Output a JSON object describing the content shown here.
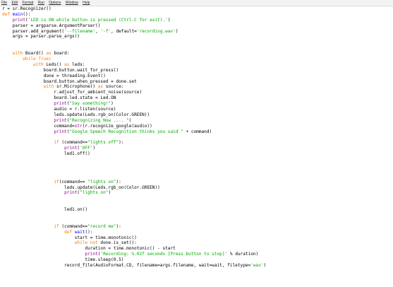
{
  "menu": [
    "File",
    "Edit",
    "Format",
    "Run",
    "Options",
    "Window",
    "Help"
  ],
  "colors": {
    "keyword": "#ff7700",
    "builtin": "#900090",
    "string": "#00aa00",
    "definition": "#0000ff",
    "default": "#000000",
    "background": "#ffffff"
  },
  "code_lines": [
    [
      [
        "",
        "r = sr.Recognizer()"
      ]
    ],
    [
      [
        "kw",
        "def "
      ],
      [
        "df",
        "main"
      ],
      [
        "",
        "():"
      ]
    ],
    [
      [
        "",
        "    "
      ],
      [
        "bi",
        "print"
      ],
      [
        "",
        "("
      ],
      [
        "str",
        "'LED is ON while button is pressed (Ctrl-C for exit).'"
      ],
      [
        "",
        ")"
      ]
    ],
    [
      [
        "",
        "    parser = argparse.ArgumentParser()"
      ]
    ],
    [
      [
        "",
        "    parser.add_argument("
      ],
      [
        "str",
        "'--filename'"
      ],
      [
        "",
        ", "
      ],
      [
        "str",
        "'-f'"
      ],
      [
        "",
        ", default="
      ],
      [
        "str",
        "'recording.wav'"
      ],
      [
        "",
        ")"
      ]
    ],
    [
      [
        "",
        "    args = parser.parse_args()"
      ]
    ],
    [
      [
        "",
        ""
      ]
    ],
    [
      [
        "",
        ""
      ]
    ],
    [
      [
        "",
        "    "
      ],
      [
        "kw",
        "with "
      ],
      [
        "",
        "Board() "
      ],
      [
        "kw",
        "as "
      ],
      [
        "",
        "board:"
      ]
    ],
    [
      [
        "",
        "        "
      ],
      [
        "kw",
        "while True"
      ],
      [
        "",
        ":"
      ]
    ],
    [
      [
        "",
        "            "
      ],
      [
        "kw",
        "with "
      ],
      [
        "",
        "Leds() "
      ],
      [
        "kw",
        "as "
      ],
      [
        "",
        "leds:"
      ]
    ],
    [
      [
        "",
        "                board.button.wait_for_press()"
      ]
    ],
    [
      [
        "",
        "                done = threading.Event()"
      ]
    ],
    [
      [
        "",
        "                board.button.when_pressed = done.set"
      ]
    ],
    [
      [
        "",
        "                "
      ],
      [
        "kw",
        "with "
      ],
      [
        "",
        "sr.Microphone() "
      ],
      [
        "kw",
        "as "
      ],
      [
        "",
        "source:"
      ]
    ],
    [
      [
        "",
        "                    r.adjust_for_ambient_noise(source)"
      ]
    ],
    [
      [
        "",
        "                    board.led.state = Led.ON"
      ]
    ],
    [
      [
        "",
        "                    "
      ],
      [
        "bi",
        "print"
      ],
      [
        "",
        "("
      ],
      [
        "str",
        "\"Say something!\""
      ],
      [
        "",
        ")"
      ]
    ],
    [
      [
        "",
        "                    audio = r.listen(source)"
      ]
    ],
    [
      [
        "",
        "                    leds.update(Leds.rgb_on(Color.GREEN))"
      ]
    ],
    [
      [
        "",
        "                    "
      ],
      [
        "bi",
        "print"
      ],
      [
        "",
        "("
      ],
      [
        "str",
        "\"Recognizing Now .... \""
      ],
      [
        "",
        ")"
      ]
    ],
    [
      [
        "",
        "                    command="
      ],
      [
        "bi",
        "str"
      ],
      [
        "",
        "(r.recognize_google(audio))"
      ]
    ],
    [
      [
        "",
        "                    "
      ],
      [
        "bi",
        "print"
      ],
      [
        "",
        "("
      ],
      [
        "str",
        "\"Google Speech Recognition thinks you said \""
      ],
      [
        "",
        " + command)"
      ]
    ],
    [
      [
        "",
        ""
      ]
    ],
    [
      [
        "",
        "                    "
      ],
      [
        "kw",
        "if "
      ],
      [
        "",
        "(command=="
      ],
      [
        "str",
        "\"lights off\""
      ],
      [
        "",
        "):"
      ]
    ],
    [
      [
        "",
        "                        "
      ],
      [
        "bi",
        "print"
      ],
      [
        "",
        "("
      ],
      [
        "str",
        "'OFF'"
      ],
      [
        "",
        ")"
      ]
    ],
    [
      [
        "",
        "                        led1.off()"
      ]
    ],
    [
      [
        "",
        ""
      ]
    ],
    [
      [
        "",
        ""
      ]
    ],
    [
      [
        "",
        ""
      ]
    ],
    [
      [
        "",
        ""
      ]
    ],
    [
      [
        "",
        "                    "
      ],
      [
        "kw",
        "if"
      ],
      [
        "",
        "(command== "
      ],
      [
        "str",
        "\"lights on\""
      ],
      [
        "",
        "):"
      ]
    ],
    [
      [
        "",
        "                        leds.update(Leds.rgb_on(Color.GREEN))"
      ]
    ],
    [
      [
        "",
        "                        "
      ],
      [
        "bi",
        "print"
      ],
      [
        "",
        "("
      ],
      [
        "str",
        "\"lights on\""
      ],
      [
        "",
        ")"
      ]
    ],
    [
      [
        "",
        ""
      ]
    ],
    [
      [
        "",
        ""
      ]
    ],
    [
      [
        "",
        "                        led1.on()"
      ]
    ],
    [
      [
        "",
        ""
      ]
    ],
    [
      [
        "",
        ""
      ]
    ],
    [
      [
        "",
        "                    "
      ],
      [
        "kw",
        "if "
      ],
      [
        "",
        "(command=="
      ],
      [
        "str",
        "\"record me\""
      ],
      [
        "",
        "):"
      ]
    ],
    [
      [
        "",
        "                        "
      ],
      [
        "kw",
        "def "
      ],
      [
        "df",
        "wait"
      ],
      [
        "",
        "():"
      ]
    ],
    [
      [
        "",
        "                            start = time.monotonic()"
      ]
    ],
    [
      [
        "",
        "                            "
      ],
      [
        "kw",
        "while not "
      ],
      [
        "",
        "done.is_set():"
      ]
    ],
    [
      [
        "",
        "                                duration = time.monotonic() - start"
      ]
    ],
    [
      [
        "",
        "                                "
      ],
      [
        "bi",
        "print"
      ],
      [
        "",
        "("
      ],
      [
        "str",
        "'Recording: %.02f seconds [Press button to stop]'"
      ],
      [
        "",
        " % duration)"
      ]
    ],
    [
      [
        "",
        "                                time.sleep(0.5)"
      ]
    ],
    [
      [
        "",
        "                        record_file(AudioFormat.CD, filename=args.filename, wait=wait, filetype="
      ],
      [
        "str",
        "'wav'"
      ],
      [
        "",
        ")"
      ]
    ]
  ]
}
